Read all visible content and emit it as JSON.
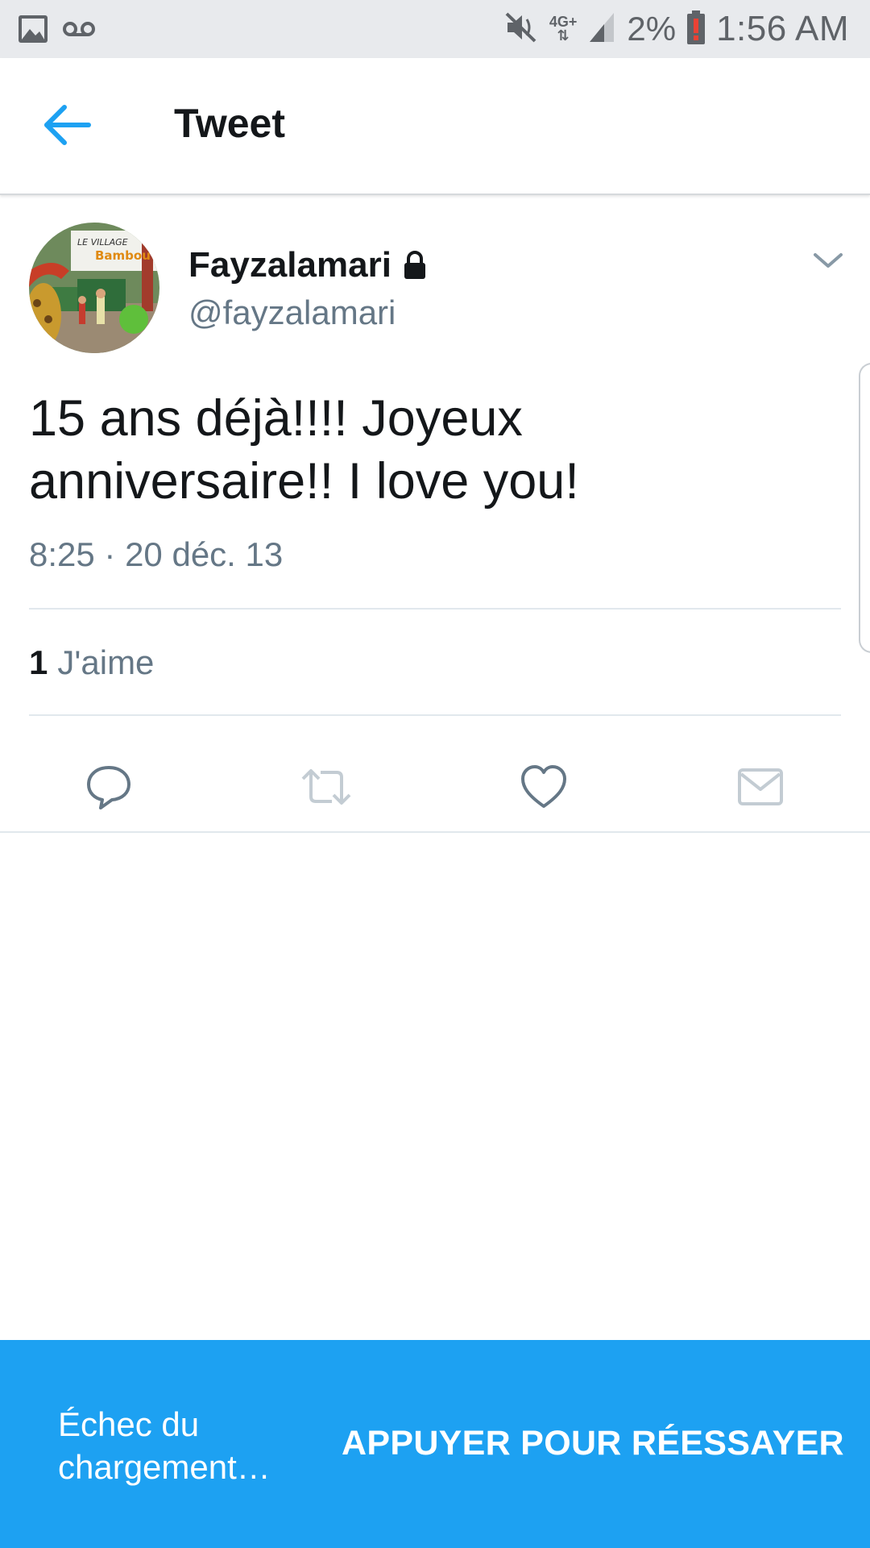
{
  "status_bar": {
    "network_label": "4G+",
    "battery_percent": "2%",
    "time": "1:56 AM",
    "icons": [
      "gallery-icon",
      "voicemail-icon",
      "mute-icon",
      "signal-icon",
      "battery-low-icon"
    ],
    "battery_alert_color": "#e94235"
  },
  "header": {
    "back_icon": "arrow-left-icon",
    "title": "Tweet",
    "accent_color": "#1da1f2"
  },
  "tweet": {
    "display_name": "Fayzalamari",
    "handle": "@fayzalamari",
    "protected_icon": "lock-icon",
    "menu_icon": "chevron-down-icon",
    "avatar_sign_text_1": "LE VILLAGE",
    "avatar_sign_text_2": "Bambou",
    "text_line_1": "15 ans déjà!!!! Joyeux",
    "text_line_2": "anniversaire!! I love you!",
    "date": "8:25 · 20 déc. 13",
    "likes_count": "1",
    "likes_label": "J'aime"
  },
  "actions": [
    {
      "name": "reply",
      "icon": "reply-icon"
    },
    {
      "name": "retweet",
      "icon": "retweet-icon"
    },
    {
      "name": "like",
      "icon": "heart-icon"
    },
    {
      "name": "direct-message",
      "icon": "mail-icon"
    }
  ],
  "snackbar": {
    "message": "Échec du chargement…",
    "action_label": "APPUYER POUR RÉESSAYER",
    "background": "#1da1f2"
  }
}
